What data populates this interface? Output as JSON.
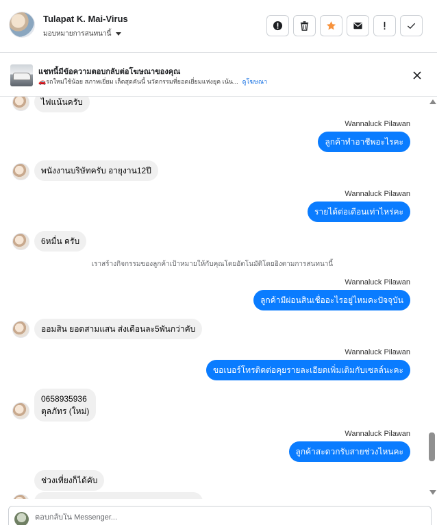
{
  "header": {
    "contact_name": "Tulapat K. Mai-Virus",
    "assign_label": "มอบหมายการสนทนานี้",
    "actions": [
      {
        "name": "spam-report-button",
        "icon": "alert-circle-icon"
      },
      {
        "name": "delete-button",
        "icon": "trash-icon"
      },
      {
        "name": "star-button",
        "icon": "star-icon"
      },
      {
        "name": "mark-unread-button",
        "icon": "envelope-icon"
      },
      {
        "name": "follow-up-button",
        "icon": "exclamation-icon"
      },
      {
        "name": "mark-done-button",
        "icon": "checkmark-icon"
      }
    ]
  },
  "ad_banner": {
    "title": "แชทนี้มีข้อความตอบกลับต่อโฆษณาของคุณ",
    "subtitle": "🚗รถใหม่ใช้น้อย สภาพเยี่ยม เล็ดสุดคันนี้ นวัตกรรมที่ยอดเยี่ยมแห่งยุค เน้น...",
    "link": "ดูโฆษณา"
  },
  "messages": [
    {
      "dir": "in",
      "text": "ไฟแน้นครับ"
    },
    {
      "dir": "out",
      "sender": "Wannaluck Pilawan",
      "text": "ลูกค้าทำอาชีพอะไรคะ"
    },
    {
      "dir": "in",
      "text": "พนังงานบริษัทครับ อายุงาน12ปี"
    },
    {
      "dir": "out",
      "sender": "Wannaluck Pilawan",
      "text": "รายได้ต่อเดือนเท่าไหร่คะ"
    },
    {
      "dir": "in",
      "text": "6หมื่น ครับ"
    },
    {
      "dir": "system",
      "text": "เราสร้างกิจกรรมของลูกค้าเป้าหมายให้กับคุณโดยอัตโนมัติโดยอิงตามการสนทนานี้"
    },
    {
      "dir": "out",
      "sender": "Wannaluck Pilawan",
      "text": "ลูกค้ามีผ่อนสินเชื่ออะไรอยู่ไหมคะปัจจุบัน"
    },
    {
      "dir": "in",
      "text": "ออมสิน ยอดสามแสน ส่งเดือนละ5พันกว่าคับ"
    },
    {
      "dir": "out",
      "sender": "Wannaluck Pilawan",
      "text": "ขอเบอร์โทรติดต่อคุยรายละเอียดเพิ่มเติมกับเซลล์นะคะ"
    },
    {
      "dir": "in",
      "text_line1": "0658935936",
      "text_line2": "ตุลภัทร (ใหม่)"
    },
    {
      "dir": "out",
      "sender": "Wannaluck Pilawan",
      "text": "ลูกค้าสะดวกรับสายช่วงไหนคะ"
    },
    {
      "dir": "in",
      "text": "ช่วงเที่ยงก็ได้คับ"
    }
  ],
  "composer": {
    "placeholder": "ตอบกลับใน Messenger..."
  },
  "colors": {
    "outgoing_bubble": "#0a7cff",
    "incoming_bubble": "#f0f0f0",
    "star_accent": "#f7923b",
    "link": "#1b74e4"
  }
}
